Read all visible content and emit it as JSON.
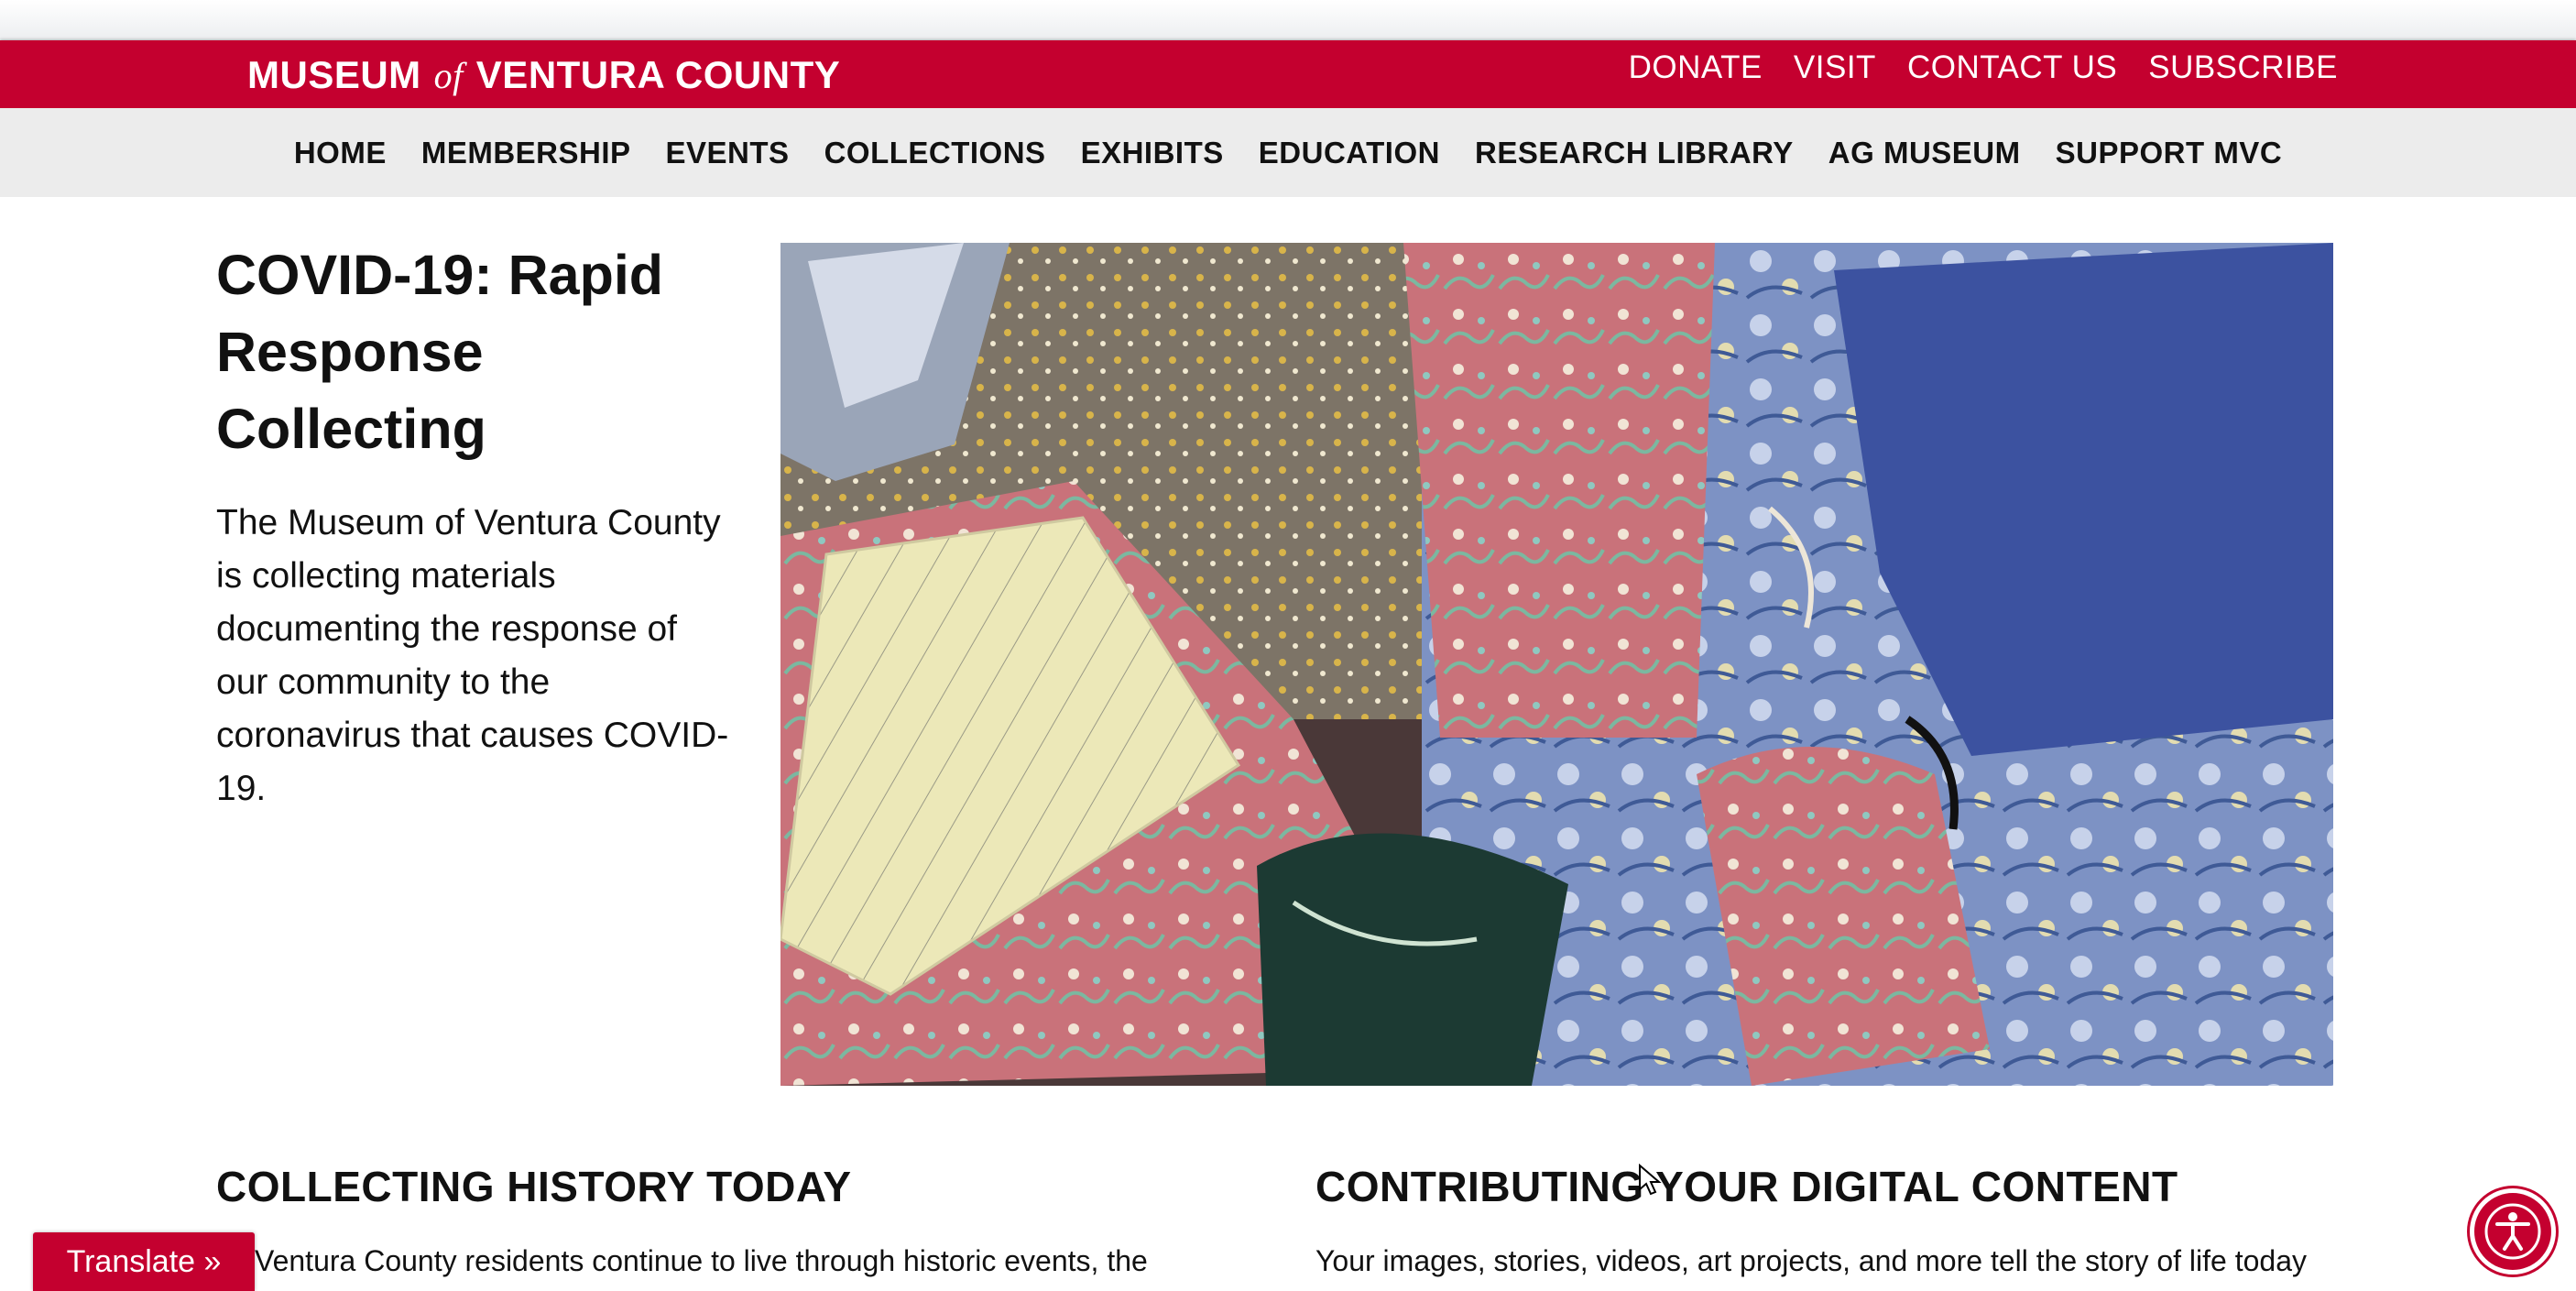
{
  "brand": {
    "logo_part1": "MUSEUM",
    "logo_of": "of",
    "logo_part2": "VENTURA COUNTY",
    "primary_color": "#c4002f"
  },
  "utility_nav": [
    "DONATE",
    "VISIT",
    "CONTACT US",
    "SUBSCRIBE"
  ],
  "main_nav": [
    "HOME",
    "MEMBERSHIP",
    "EVENTS",
    "COLLECTIONS",
    "EXHIBITS",
    "EDUCATION",
    "RESEARCH LIBRARY",
    "AG MUSEUM",
    "SUPPORT MVC"
  ],
  "hero": {
    "title": "COVID-19: Rapid Response Collecting",
    "text": "The Museum of Ventura County is collecting materials documenting the response of our community to the coronavirus that causes COVID-19."
  },
  "sections": [
    {
      "title": "COLLECTING HISTORY TODAY",
      "text": "Ventura County residents continue to live through historic events, the"
    },
    {
      "title": "CONTRIBUTING YOUR DIGITAL CONTENT",
      "text": "Your images, stories, videos, art projects, and more tell the story of life today"
    }
  ],
  "translate_label": "Translate »",
  "icons": {
    "accessibility": "accessibility-icon",
    "cursor": "mouse-cursor-icon"
  }
}
